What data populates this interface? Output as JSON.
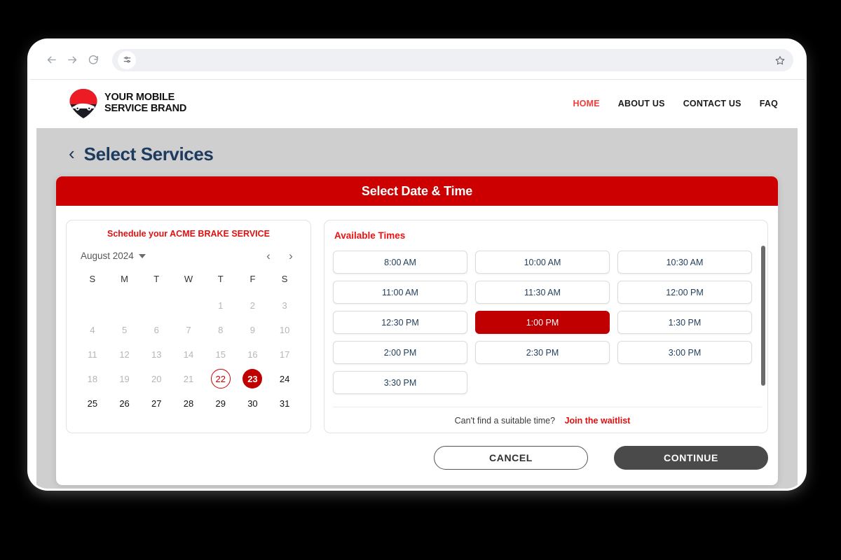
{
  "browser": {
    "back_label": "Back",
    "forward_label": "Forward",
    "reload_label": "Reload",
    "url_value": "",
    "url_placeholder": "",
    "site_settings_icon": "sliders-icon",
    "bookmark_icon": "star-icon"
  },
  "site": {
    "brand_name": "YOUR MOBILE\nSERVICE BRAND",
    "nav": [
      {
        "label": "HOME",
        "active": true
      },
      {
        "label": "ABOUT US",
        "active": false
      },
      {
        "label": "CONTACT US",
        "active": false
      },
      {
        "label": "FAQ",
        "active": false
      }
    ]
  },
  "page": {
    "back_chevron": "‹",
    "title": "Select Services"
  },
  "modal": {
    "header_title": "Select Date & Time",
    "schedule_note": "Schedule your ACME BRAKE SERVICE",
    "calendar": {
      "month_label": "August 2024",
      "prev_label": "‹",
      "next_label": "›",
      "weekdays": [
        "S",
        "M",
        "T",
        "W",
        "T",
        "F",
        "S"
      ],
      "leading_blanks": 4,
      "days": [
        {
          "n": "1",
          "state": "disabled"
        },
        {
          "n": "2",
          "state": "disabled"
        },
        {
          "n": "3",
          "state": "disabled"
        },
        {
          "n": "4",
          "state": "disabled"
        },
        {
          "n": "5",
          "state": "disabled"
        },
        {
          "n": "6",
          "state": "disabled"
        },
        {
          "n": "7",
          "state": "disabled"
        },
        {
          "n": "8",
          "state": "disabled"
        },
        {
          "n": "9",
          "state": "disabled"
        },
        {
          "n": "10",
          "state": "disabled"
        },
        {
          "n": "11",
          "state": "disabled"
        },
        {
          "n": "12",
          "state": "disabled"
        },
        {
          "n": "13",
          "state": "disabled"
        },
        {
          "n": "14",
          "state": "disabled"
        },
        {
          "n": "15",
          "state": "disabled"
        },
        {
          "n": "16",
          "state": "disabled"
        },
        {
          "n": "17",
          "state": "disabled"
        },
        {
          "n": "18",
          "state": "disabled"
        },
        {
          "n": "19",
          "state": "disabled"
        },
        {
          "n": "20",
          "state": "disabled"
        },
        {
          "n": "21",
          "state": "disabled"
        },
        {
          "n": "22",
          "state": "today"
        },
        {
          "n": "23",
          "state": "selected"
        },
        {
          "n": "24",
          "state": "enabled"
        },
        {
          "n": "25",
          "state": "enabled"
        },
        {
          "n": "26",
          "state": "enabled"
        },
        {
          "n": "27",
          "state": "enabled"
        },
        {
          "n": "28",
          "state": "enabled"
        },
        {
          "n": "29",
          "state": "enabled"
        },
        {
          "n": "30",
          "state": "enabled"
        },
        {
          "n": "31",
          "state": "enabled"
        }
      ]
    },
    "times": {
      "title": "Available Times",
      "slots": [
        {
          "label": "8:00 AM",
          "selected": false
        },
        {
          "label": "10:00 AM",
          "selected": false
        },
        {
          "label": "10:30 AM",
          "selected": false
        },
        {
          "label": "11:00 AM",
          "selected": false
        },
        {
          "label": "11:30 AM",
          "selected": false
        },
        {
          "label": "12:00 PM",
          "selected": false
        },
        {
          "label": "12:30 PM",
          "selected": false
        },
        {
          "label": "1:00 PM",
          "selected": true
        },
        {
          "label": "1:30 PM",
          "selected": false
        },
        {
          "label": "2:00 PM",
          "selected": false
        },
        {
          "label": "2:30 PM",
          "selected": false
        },
        {
          "label": "3:00 PM",
          "selected": false
        },
        {
          "label": "3:30 PM",
          "selected": false
        }
      ],
      "waitlist_prompt": "Can't find a suitable time?",
      "waitlist_link": "Join the waitlist"
    },
    "actions": {
      "cancel_label": "CANCEL",
      "continue_label": "CONTINUE"
    }
  },
  "colors": {
    "brand_red": "#cc0000",
    "accent_red": "#e01010",
    "title_navy": "#1d3a5f",
    "continue_gray": "#4a4a4a",
    "page_gray": "#cfcfcf"
  }
}
